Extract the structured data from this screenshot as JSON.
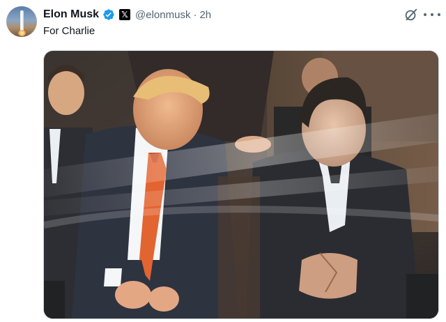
{
  "post": {
    "author_name": "Elon Musk",
    "verified_icon": "verified-badge-icon",
    "affiliation_badge": "𝕏",
    "handle": "@elonmusk",
    "separator": "·",
    "timestamp": "2h",
    "text": "For Charlie",
    "actions": {
      "grok_icon": "grok-icon",
      "more_icon": "more-options-icon"
    },
    "media_alt": "Two men in suits seated and talking behind a glass panel"
  },
  "colors": {
    "text_primary": "#0f1419",
    "text_secondary": "#536471",
    "verified_blue": "#1d9bf0",
    "tie_orange": "#e0571f"
  }
}
